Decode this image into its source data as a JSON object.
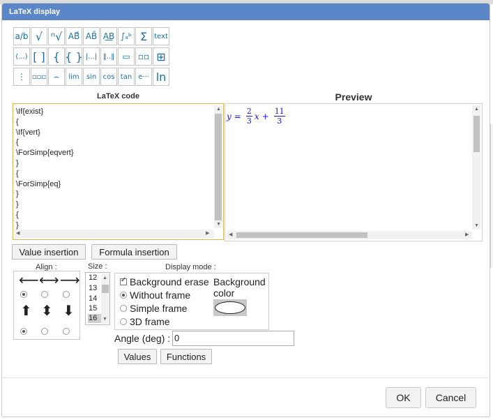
{
  "dialog": {
    "title": "LaTeX display"
  },
  "toolbar": [
    {
      "label": "a/b",
      "name": "fraction-icon"
    },
    {
      "label": "√",
      "name": "sqrt-icon"
    },
    {
      "label": "ⁿ√",
      "name": "nth-root-icon"
    },
    {
      "label": "AB⃗",
      "name": "vector-icon"
    },
    {
      "label": "AB̄",
      "name": "segment-icon"
    },
    {
      "label": "A͟B",
      "name": "underline-icon"
    },
    {
      "label": "∫ₐᵇ",
      "name": "integral-icon"
    },
    {
      "label": "Σ",
      "name": "sum-icon"
    },
    {
      "label": "text",
      "name": "text-icon"
    },
    {
      "label": "(...)",
      "name": "parentheses-icon"
    },
    {
      "label": "[ ]",
      "name": "brackets-icon"
    },
    {
      "label": "{",
      "name": "left-brace-icon"
    },
    {
      "label": "{ }",
      "name": "braces-icon"
    },
    {
      "label": "|...|",
      "name": "absolute-value-icon"
    },
    {
      "label": "‖..‖",
      "name": "norm-icon"
    },
    {
      "label": "▭",
      "name": "vertical-two-boxes-icon"
    },
    {
      "label": "▫▫",
      "name": "horizontal-two-boxes-icon"
    },
    {
      "label": "⊞",
      "name": "grid-boxes-icon"
    },
    {
      "label": "⋮",
      "name": "vertical-three-boxes-icon"
    },
    {
      "label": "▫▫▫",
      "name": "horizontal-three-boxes-icon"
    },
    {
      "label": "⌢",
      "name": "arc-icon"
    },
    {
      "label": "lim",
      "name": "limit-icon"
    },
    {
      "label": "sin",
      "name": "sin-icon"
    },
    {
      "label": "cos",
      "name": "cos-icon"
    },
    {
      "label": "tan",
      "name": "tan-icon"
    },
    {
      "label": "e···",
      "name": "exponential-icon"
    },
    {
      "label": "ln",
      "name": "ln-icon"
    }
  ],
  "code_panel": {
    "label": "LaTeX code",
    "lines": [
      "\\If{exist}",
      "{",
      "\\If{vert}",
      "{",
      "\\ForSimp{eqvert}",
      "}",
      "{",
      "\\ForSimp{eq}",
      "}",
      "}",
      "{",
      "}"
    ]
  },
  "preview_panel": {
    "label": "Preview",
    "y": "y",
    "equals": "=",
    "frac1_num": "2",
    "frac1_den": "3",
    "x": "x",
    "plus": "+",
    "frac2_num": "11",
    "frac2_den": "3"
  },
  "buttons": {
    "value_insertion": "Value insertion",
    "formula_insertion": "Formula insertion",
    "values": "Values",
    "functions": "Functions",
    "ok": "OK",
    "cancel": "Cancel"
  },
  "align": {
    "label": "Align :",
    "horizontal_selected": "left",
    "vertical_selected": "top"
  },
  "size": {
    "label": "Size :",
    "options": [
      "12",
      "13",
      "14",
      "15",
      "16"
    ],
    "selected": "16"
  },
  "display_mode": {
    "label": "Display mode :",
    "background_erase": "Background erase",
    "background_erase_checked": true,
    "modes": [
      "Without frame",
      "Simple frame",
      "3D frame"
    ],
    "selected_mode": "Without frame",
    "background_color_label": "Background color"
  },
  "angle": {
    "label": "Angle (deg) :",
    "value": "0"
  }
}
